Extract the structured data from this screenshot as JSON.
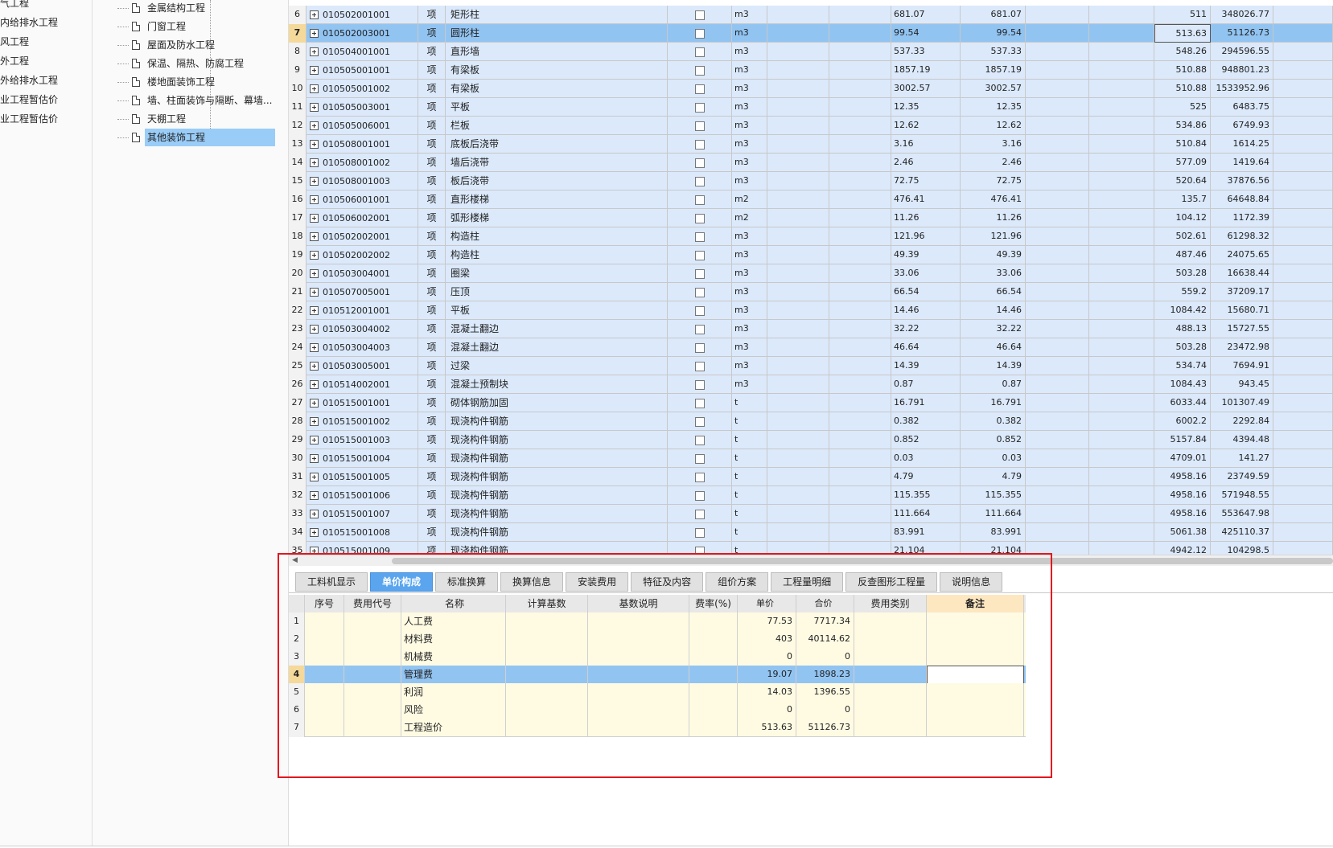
{
  "left_panel": {
    "items": [
      "燃气工程",
      "室内给排水工程",
      "通风工程",
      "室外工程",
      "室外给排水工程",
      "专业工程暂估价",
      "专业工程暂估价"
    ]
  },
  "tree": {
    "items": [
      {
        "label": "金属结构工程",
        "selected": false
      },
      {
        "label": "门窗工程",
        "selected": false
      },
      {
        "label": "屋面及防水工程",
        "selected": false
      },
      {
        "label": "保温、隔热、防腐工程",
        "selected": false
      },
      {
        "label": "楼地面装饰工程",
        "selected": false
      },
      {
        "label": "墙、柱面装饰与隔断、幕墙...",
        "selected": false
      },
      {
        "label": "天棚工程",
        "selected": false
      },
      {
        "label": "其他装饰工程",
        "selected": true
      }
    ]
  },
  "grid": {
    "rows": [
      {
        "idx": "6",
        "code": "010502001001",
        "type": "项",
        "name": "矩形柱",
        "unit": "m3",
        "qty1": "681.07",
        "qty2": "681.07",
        "price": "511",
        "total": "348026.77",
        "selected": false
      },
      {
        "idx": "7",
        "code": "010502003001",
        "type": "项",
        "name": "圆形柱",
        "unit": "m3",
        "qty1": "99.54",
        "qty2": "99.54",
        "price": "513.63",
        "total": "51126.73",
        "selected": true
      },
      {
        "idx": "8",
        "code": "010504001001",
        "type": "项",
        "name": "直形墙",
        "unit": "m3",
        "qty1": "537.33",
        "qty2": "537.33",
        "price": "548.26",
        "total": "294596.55",
        "selected": false
      },
      {
        "idx": "9",
        "code": "010505001001",
        "type": "项",
        "name": "有梁板",
        "unit": "m3",
        "qty1": "1857.19",
        "qty2": "1857.19",
        "price": "510.88",
        "total": "948801.23",
        "selected": false
      },
      {
        "idx": "10",
        "code": "010505001002",
        "type": "项",
        "name": "有梁板",
        "unit": "m3",
        "qty1": "3002.57",
        "qty2": "3002.57",
        "price": "510.88",
        "total": "1533952.96",
        "selected": false
      },
      {
        "idx": "11",
        "code": "010505003001",
        "type": "项",
        "name": "平板",
        "unit": "m3",
        "qty1": "12.35",
        "qty2": "12.35",
        "price": "525",
        "total": "6483.75",
        "selected": false
      },
      {
        "idx": "12",
        "code": "010505006001",
        "type": "项",
        "name": "栏板",
        "unit": "m3",
        "qty1": "12.62",
        "qty2": "12.62",
        "price": "534.86",
        "total": "6749.93",
        "selected": false
      },
      {
        "idx": "13",
        "code": "010508001001",
        "type": "项",
        "name": "底板后浇带",
        "unit": "m3",
        "qty1": "3.16",
        "qty2": "3.16",
        "price": "510.84",
        "total": "1614.25",
        "selected": false
      },
      {
        "idx": "14",
        "code": "010508001002",
        "type": "项",
        "name": "墙后浇带",
        "unit": "m3",
        "qty1": "2.46",
        "qty2": "2.46",
        "price": "577.09",
        "total": "1419.64",
        "selected": false
      },
      {
        "idx": "15",
        "code": "010508001003",
        "type": "项",
        "name": "板后浇带",
        "unit": "m3",
        "qty1": "72.75",
        "qty2": "72.75",
        "price": "520.64",
        "total": "37876.56",
        "selected": false
      },
      {
        "idx": "16",
        "code": "010506001001",
        "type": "项",
        "name": "直形楼梯",
        "unit": "m2",
        "qty1": "476.41",
        "qty2": "476.41",
        "price": "135.7",
        "total": "64648.84",
        "selected": false
      },
      {
        "idx": "17",
        "code": "010506002001",
        "type": "项",
        "name": "弧形楼梯",
        "unit": "m2",
        "qty1": "11.26",
        "qty2": "11.26",
        "price": "104.12",
        "total": "1172.39",
        "selected": false
      },
      {
        "idx": "18",
        "code": "010502002001",
        "type": "项",
        "name": "构造柱",
        "unit": "m3",
        "qty1": "121.96",
        "qty2": "121.96",
        "price": "502.61",
        "total": "61298.32",
        "selected": false
      },
      {
        "idx": "19",
        "code": "010502002002",
        "type": "项",
        "name": "构造柱",
        "unit": "m3",
        "qty1": "49.39",
        "qty2": "49.39",
        "price": "487.46",
        "total": "24075.65",
        "selected": false
      },
      {
        "idx": "20",
        "code": "010503004001",
        "type": "项",
        "name": "圈梁",
        "unit": "m3",
        "qty1": "33.06",
        "qty2": "33.06",
        "price": "503.28",
        "total": "16638.44",
        "selected": false
      },
      {
        "idx": "21",
        "code": "010507005001",
        "type": "项",
        "name": "压顶",
        "unit": "m3",
        "qty1": "66.54",
        "qty2": "66.54",
        "price": "559.2",
        "total": "37209.17",
        "selected": false
      },
      {
        "idx": "22",
        "code": "010512001001",
        "type": "项",
        "name": "平板",
        "unit": "m3",
        "qty1": "14.46",
        "qty2": "14.46",
        "price": "1084.42",
        "total": "15680.71",
        "selected": false
      },
      {
        "idx": "23",
        "code": "010503004002",
        "type": "项",
        "name": "混凝土翻边",
        "unit": "m3",
        "qty1": "32.22",
        "qty2": "32.22",
        "price": "488.13",
        "total": "15727.55",
        "selected": false
      },
      {
        "idx": "24",
        "code": "010503004003",
        "type": "项",
        "name": "混凝土翻边",
        "unit": "m3",
        "qty1": "46.64",
        "qty2": "46.64",
        "price": "503.28",
        "total": "23472.98",
        "selected": false
      },
      {
        "idx": "25",
        "code": "010503005001",
        "type": "项",
        "name": "过梁",
        "unit": "m3",
        "qty1": "14.39",
        "qty2": "14.39",
        "price": "534.74",
        "total": "7694.91",
        "selected": false
      },
      {
        "idx": "26",
        "code": "010514002001",
        "type": "项",
        "name": "混凝土预制块",
        "unit": "m3",
        "qty1": "0.87",
        "qty2": "0.87",
        "price": "1084.43",
        "total": "943.45",
        "selected": false
      },
      {
        "idx": "27",
        "code": "010515001001",
        "type": "项",
        "name": "砌体钢筋加固",
        "unit": "t",
        "qty1": "16.791",
        "qty2": "16.791",
        "price": "6033.44",
        "total": "101307.49",
        "selected": false
      },
      {
        "idx": "28",
        "code": "010515001002",
        "type": "项",
        "name": "现浇构件钢筋",
        "unit": "t",
        "qty1": "0.382",
        "qty2": "0.382",
        "price": "6002.2",
        "total": "2292.84",
        "selected": false
      },
      {
        "idx": "29",
        "code": "010515001003",
        "type": "项",
        "name": "现浇构件钢筋",
        "unit": "t",
        "qty1": "0.852",
        "qty2": "0.852",
        "price": "5157.84",
        "total": "4394.48",
        "selected": false
      },
      {
        "idx": "30",
        "code": "010515001004",
        "type": "项",
        "name": "现浇构件钢筋",
        "unit": "t",
        "qty1": "0.03",
        "qty2": "0.03",
        "price": "4709.01",
        "total": "141.27",
        "selected": false
      },
      {
        "idx": "31",
        "code": "010515001005",
        "type": "项",
        "name": "现浇构件钢筋",
        "unit": "t",
        "qty1": "4.79",
        "qty2": "4.79",
        "price": "4958.16",
        "total": "23749.59",
        "selected": false
      },
      {
        "idx": "32",
        "code": "010515001006",
        "type": "项",
        "name": "现浇构件钢筋",
        "unit": "t",
        "qty1": "115.355",
        "qty2": "115.355",
        "price": "4958.16",
        "total": "571948.55",
        "selected": false
      },
      {
        "idx": "33",
        "code": "010515001007",
        "type": "项",
        "name": "现浇构件钢筋",
        "unit": "t",
        "qty1": "111.664",
        "qty2": "111.664",
        "price": "4958.16",
        "total": "553647.98",
        "selected": false
      },
      {
        "idx": "34",
        "code": "010515001008",
        "type": "项",
        "name": "现浇构件钢筋",
        "unit": "t",
        "qty1": "83.991",
        "qty2": "83.991",
        "price": "5061.38",
        "total": "425110.37",
        "selected": false
      },
      {
        "idx": "35",
        "code": "010515001009",
        "type": "项",
        "name": "现浇构件钢筋",
        "unit": "t",
        "qty1": "21.104",
        "qty2": "21.104",
        "price": "4942.12",
        "total": "104298.5",
        "selected": false
      }
    ]
  },
  "bottom": {
    "tabs": [
      {
        "label": "工料机显示",
        "active": false
      },
      {
        "label": "单价构成",
        "active": true
      },
      {
        "label": "标准换算",
        "active": false
      },
      {
        "label": "换算信息",
        "active": false
      },
      {
        "label": "安装费用",
        "active": false
      },
      {
        "label": "特征及内容",
        "active": false
      },
      {
        "label": "组价方案",
        "active": false
      },
      {
        "label": "工程量明细",
        "active": false
      },
      {
        "label": "反查图形工程量",
        "active": false
      },
      {
        "label": "说明信息",
        "active": false
      }
    ],
    "headers": [
      "",
      "序号",
      "费用代号",
      "名称",
      "计算基数",
      "基数说明",
      "费率(%)",
      "单价",
      "合价",
      "费用类别",
      "备注"
    ],
    "rows": [
      {
        "idx": "1",
        "name": "人工费",
        "price": "77.53",
        "total": "7717.34",
        "selected": false
      },
      {
        "idx": "2",
        "name": "材料费",
        "price": "403",
        "total": "40114.62",
        "selected": false
      },
      {
        "idx": "3",
        "name": "机械费",
        "price": "0",
        "total": "0",
        "selected": false
      },
      {
        "idx": "4",
        "name": "管理费",
        "price": "19.07",
        "total": "1898.23",
        "selected": true
      },
      {
        "idx": "5",
        "name": "利润",
        "price": "14.03",
        "total": "1396.55",
        "selected": false
      },
      {
        "idx": "6",
        "name": "风险",
        "price": "0",
        "total": "0",
        "selected": false
      },
      {
        "idx": "7",
        "name": "工程造价",
        "price": "513.63",
        "total": "51126.73",
        "selected": false
      }
    ]
  },
  "colors": {
    "row_bg": "#dbe9fb",
    "row_selected": "#92c4f2",
    "tab_active": "#5aa5ee",
    "bottom_row_bg": "#fffbe3",
    "highlight_box": "#e3161e"
  }
}
